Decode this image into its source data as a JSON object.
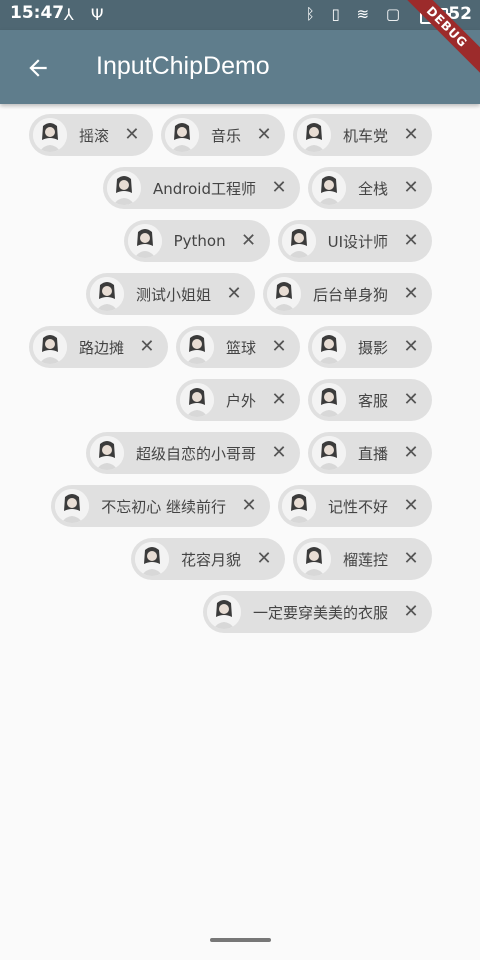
{
  "status_bar": {
    "time": "15:47",
    "left_icons": "⅄ Ψ",
    "right_icons": "ᛒ ▯ ≋ ▢",
    "battery_level": "52"
  },
  "debug_banner": "DEBUG",
  "app_bar": {
    "title": "InputChipDemo",
    "back_icon": "arrow-back-icon"
  },
  "chips": [
    {
      "label": "摇滚"
    },
    {
      "label": "音乐"
    },
    {
      "label": "机车党"
    },
    {
      "label": "Android工程师"
    },
    {
      "label": "全栈"
    },
    {
      "label": "Python"
    },
    {
      "label": "UI设计师"
    },
    {
      "label": "测试小姐姐"
    },
    {
      "label": "后台单身狗"
    },
    {
      "label": "路边摊"
    },
    {
      "label": "篮球"
    },
    {
      "label": "摄影"
    },
    {
      "label": "户外"
    },
    {
      "label": "客服"
    },
    {
      "label": "超级自恋的小哥哥"
    },
    {
      "label": "直播"
    },
    {
      "label": "不忘初心 继续前行"
    },
    {
      "label": "记性不好"
    },
    {
      "label": "花容月貌"
    },
    {
      "label": "榴莲控"
    },
    {
      "label": "一定要穿美美的衣服"
    }
  ],
  "chip_delete_glyph": "✕",
  "colors": {
    "app_bar": "#5f7d8c",
    "status_bar": "#4f6773",
    "chip_background": "#e0e0e0",
    "background": "#fafafa"
  }
}
